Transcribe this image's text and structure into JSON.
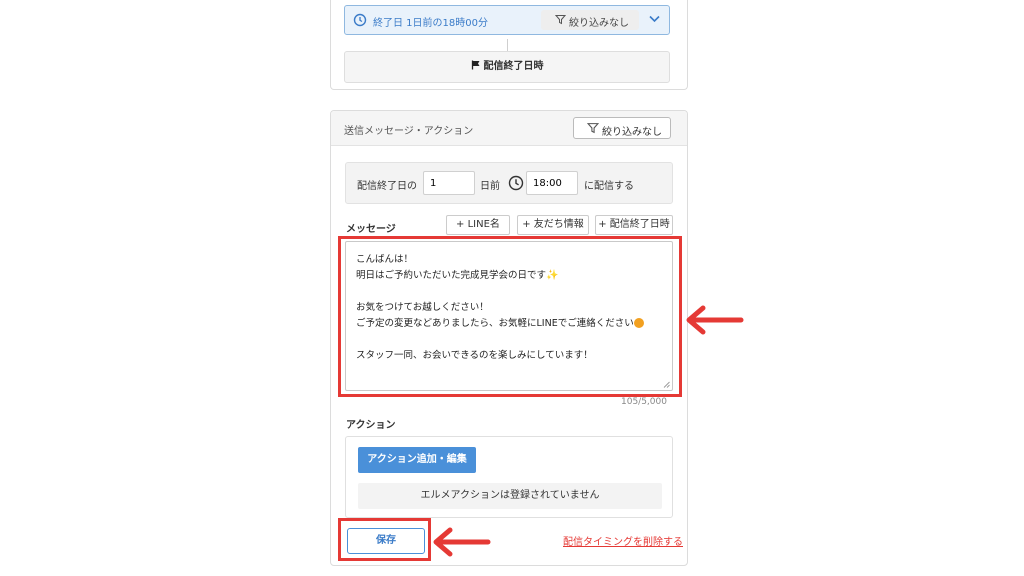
{
  "top_panel": {
    "end_condition": "終了日 1日前の18時00分",
    "filter_label": "絞り込みなし",
    "end_block_label": "配信終了日時"
  },
  "main_panel": {
    "header_title": "送信メッセージ・アクション",
    "header_filter_label": "絞り込みなし",
    "timing": {
      "prefix": "配信終了日の",
      "days_value": "1",
      "days_suffix": "日前",
      "time_value": "18:00",
      "suffix": "に配信する"
    },
    "message_label": "メッセージ",
    "insert_buttons": [
      "+ LINE名",
      "+ 友だち情報",
      "+ 配信終了日時"
    ],
    "message_lines": [
      "こんばんは！",
      "明日はご予約いただいた完成見学会の日です",
      "",
      "お気をつけてお越しください！",
      "ご予定の変更などありましたら、お気軽にLINEでご連絡ください",
      "",
      "スタッフ一同、お会いできるのを楽しみにしています！"
    ],
    "char_counter": "105/5,000",
    "action_label": "アクション",
    "action_button_label": "アクション追加・編集",
    "no_action_text": "エルメアクションは登録されていません",
    "save_label": "保存",
    "delete_link_label": "配信タイミングを削除する"
  },
  "colors": {
    "accent_blue": "#4a90d9",
    "highlight_red": "#e53935"
  },
  "icons": {
    "clock": "clock-icon",
    "filter": "filter-icon",
    "chevron": "chevron-down-icon",
    "flag": "flag-icon",
    "arrow": "arrow-left-icon"
  }
}
